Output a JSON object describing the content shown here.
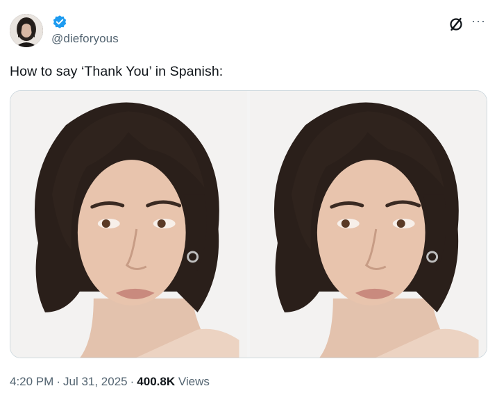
{
  "author": {
    "handle": "@dieforyous",
    "verified": true,
    "verified_color": "#1d9bf0"
  },
  "post": {
    "text": "How to say ‘Thank You’ in Spanish:",
    "media_count": 2,
    "media_description": "two identical portrait photos"
  },
  "meta": {
    "time": "4:20 PM",
    "separator": "·",
    "date": "Jul 31, 2025",
    "views_count": "400.8K",
    "views_label": "Views"
  },
  "icons": {
    "grok": "grok-icon",
    "more": "more-icon",
    "more_glyph": "···"
  },
  "colors": {
    "text_primary": "#0f1419",
    "text_secondary": "#536471",
    "border": "#cfd9de"
  }
}
